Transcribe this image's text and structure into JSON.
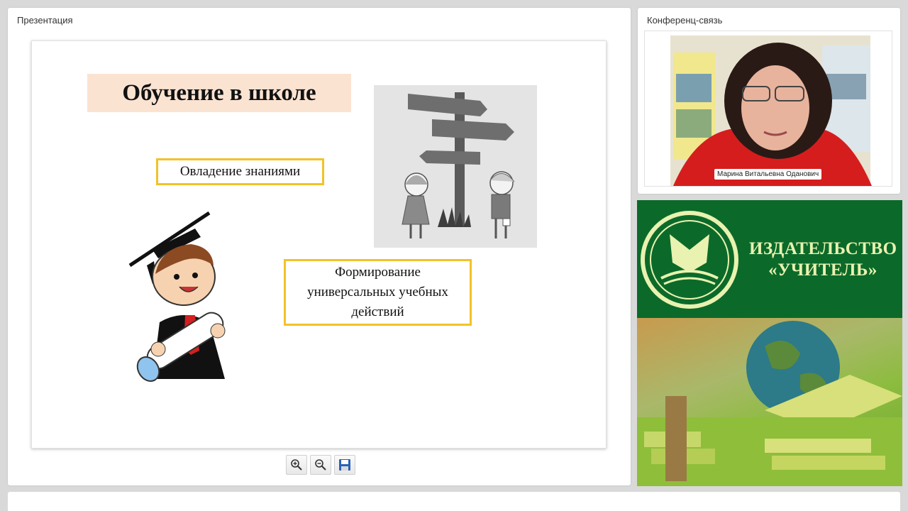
{
  "presentation": {
    "panel_title": "Презентация",
    "slide": {
      "title": "Обучение в школе",
      "box_knowledge": "Овладение знаниями",
      "box_uud": "Формирование универсальных учебных действий"
    },
    "toolbar": {
      "zoom_in_icon": "zoom-in-icon",
      "zoom_out_icon": "zoom-out-icon",
      "save_icon": "floppy-disk-icon"
    }
  },
  "conference": {
    "panel_title": "Конференц-связь",
    "participant_name": "Марина Витальевна Оданович"
  },
  "banner": {
    "line1": "ИЗДАТЕЛЬСТВО",
    "line2": "«УЧИТЕЛЬ»",
    "colors": {
      "green": "#0b6a2a",
      "text": "#e9f2b0"
    }
  }
}
